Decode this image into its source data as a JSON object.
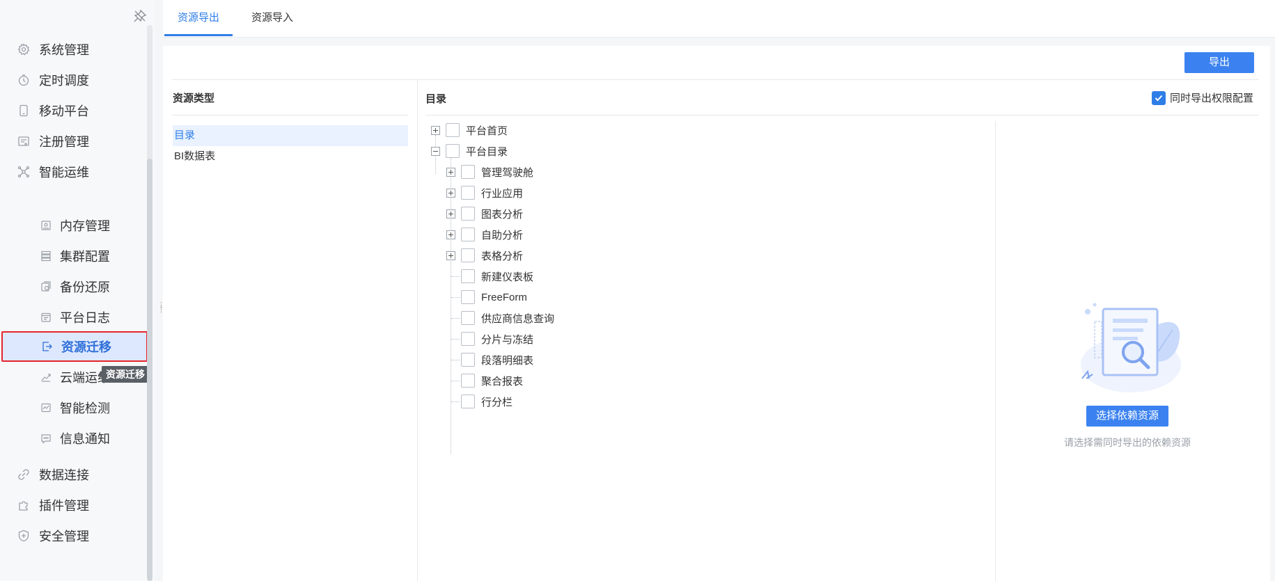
{
  "tabs": [
    {
      "label": "资源导出",
      "active": true
    },
    {
      "label": "资源导入",
      "active": false
    }
  ],
  "sidebar": {
    "items": [
      {
        "label": "系统管理",
        "icon": "gear-icon"
      },
      {
        "label": "定时调度",
        "icon": "timer-icon"
      },
      {
        "label": "移动平台",
        "icon": "mobile-icon"
      },
      {
        "label": "注册管理",
        "icon": "register-icon"
      },
      {
        "label": "智能运维",
        "icon": "network-icon"
      }
    ],
    "sub_items": [
      {
        "label": "内存管理",
        "icon": "memory-icon"
      },
      {
        "label": "集群配置",
        "icon": "server-stack-icon"
      },
      {
        "label": "备份还原",
        "icon": "backup-icon"
      },
      {
        "label": "平台日志",
        "icon": "log-icon"
      },
      {
        "label": "资源迁移",
        "icon": "migrate-icon",
        "active": true
      },
      {
        "label": "云端运维",
        "icon": "cloud-chart-icon"
      },
      {
        "label": "智能检测",
        "icon": "monitor-icon"
      },
      {
        "label": "信息通知",
        "icon": "message-icon"
      }
    ],
    "bottom_items": [
      {
        "label": "数据连接",
        "icon": "link-icon"
      },
      {
        "label": "插件管理",
        "icon": "puzzle-icon"
      },
      {
        "label": "安全管理",
        "icon": "shield-icon"
      }
    ],
    "tooltip": "资源迁移"
  },
  "toolbar": {
    "export_label": "导出"
  },
  "resource_types": {
    "title": "资源类型",
    "items": [
      {
        "label": "目录",
        "active": true
      },
      {
        "label": "BI数据表",
        "active": false
      }
    ]
  },
  "directory": {
    "title": "目录",
    "sync_permission_label": "同时导出权限配置",
    "sync_permission_checked": true,
    "tree": [
      {
        "label": "平台首页",
        "level": 0,
        "expander": "plus"
      },
      {
        "label": "平台目录",
        "level": 0,
        "expander": "minus"
      },
      {
        "label": "管理驾驶舱",
        "level": 1,
        "expander": "plus"
      },
      {
        "label": "行业应用",
        "level": 1,
        "expander": "plus"
      },
      {
        "label": "图表分析",
        "level": 1,
        "expander": "plus"
      },
      {
        "label": "自助分析",
        "level": 1,
        "expander": "plus"
      },
      {
        "label": "表格分析",
        "level": 1,
        "expander": "plus"
      },
      {
        "label": "新建仪表板",
        "level": 1,
        "expander": "none"
      },
      {
        "label": "FreeForm",
        "level": 1,
        "expander": "none"
      },
      {
        "label": "供应商信息查询",
        "level": 1,
        "expander": "none"
      },
      {
        "label": "分片与冻结",
        "level": 1,
        "expander": "none"
      },
      {
        "label": "段落明细表",
        "level": 1,
        "expander": "none"
      },
      {
        "label": "聚合报表",
        "level": 1,
        "expander": "none"
      },
      {
        "label": "行分栏",
        "level": 1,
        "expander": "none"
      }
    ]
  },
  "dependencies": {
    "button_label": "选择依赖资源",
    "hint": "请选择需同时导出的依赖资源"
  }
}
